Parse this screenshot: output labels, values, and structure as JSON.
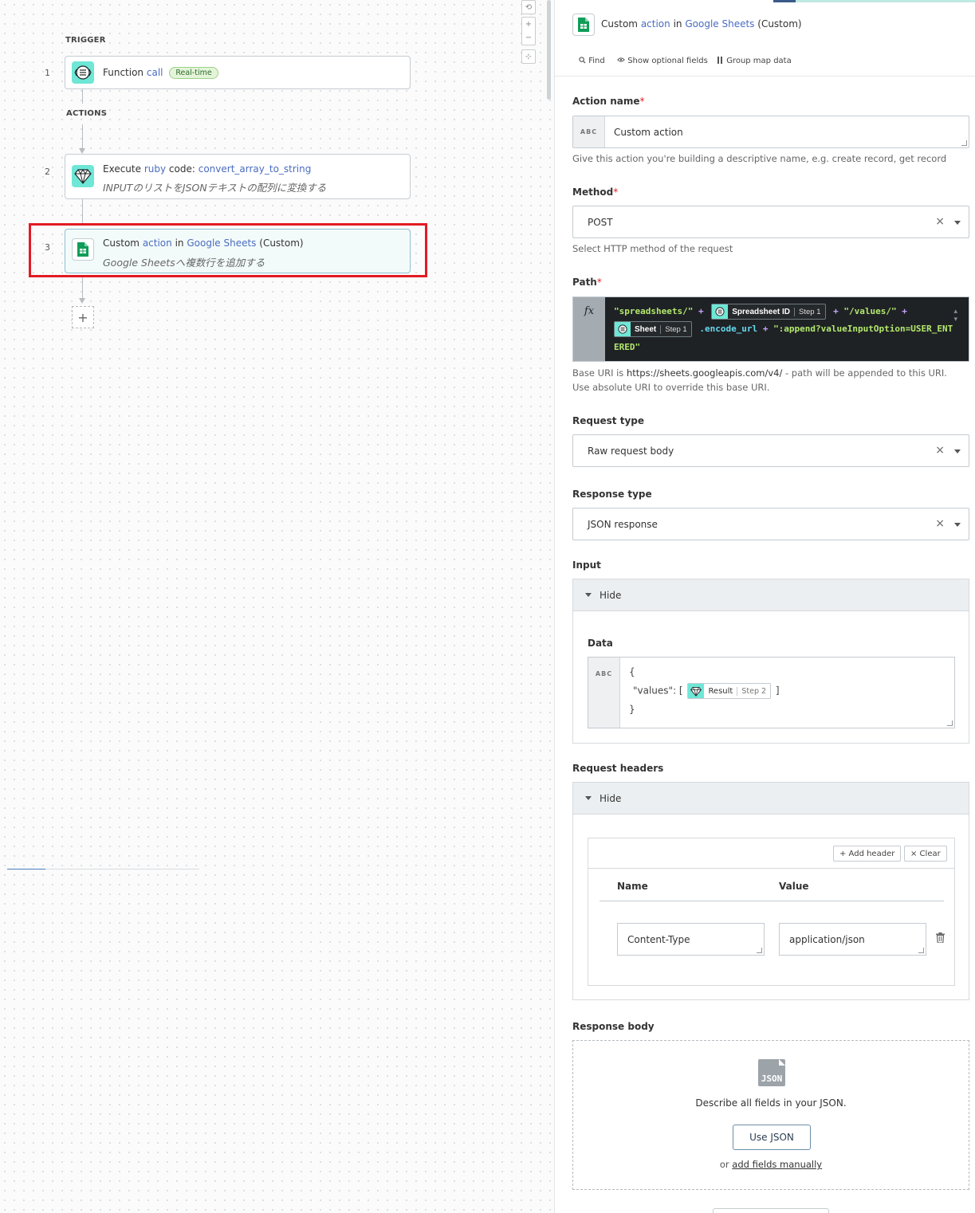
{
  "canvas": {
    "trigger_label": "TRIGGER",
    "actions_label": "ACTIONS",
    "steps": [
      {
        "num": "1",
        "prefix": "Function",
        "keyword": "call",
        "badge": "Real-time"
      },
      {
        "num": "2",
        "prefix": "Execute",
        "keyword": "ruby",
        "middle": "code:",
        "name": "convert_array_to_string",
        "description": "INPUTのリストをJSONテキストの配列に変換する"
      },
      {
        "num": "3",
        "prefix": "Custom",
        "keyword": "action",
        "middle": "in",
        "app": "Google Sheets",
        "suffix": "(Custom)",
        "description": "Google Sheetsへ複数行を追加する"
      }
    ],
    "add_step_label": "+",
    "zoom": {
      "reset": "⟲",
      "in": "+",
      "out": "−",
      "fit": "⊹"
    }
  },
  "panel": {
    "title": {
      "prefix": "Custom",
      "keyword": "action",
      "middle": "in",
      "app": "Google Sheets",
      "suffix": "(Custom)"
    },
    "toolbar": {
      "find": "Find",
      "optional": "Show optional fields",
      "group": "Group map data"
    },
    "action_name": {
      "label": "Action name",
      "value": "Custom action",
      "hint": "Give this action you're building a descriptive name, e.g. create record, get record",
      "abc": "ABC"
    },
    "method": {
      "label": "Method",
      "value": "POST",
      "hint": "Select HTTP method of the request"
    },
    "path": {
      "label": "Path",
      "fx": "fx",
      "s1": "\"spreadsheets/\"",
      "plus": "+",
      "pill1_name": "Spreadsheet ID",
      "pill1_step": "Step 1",
      "s2": "\"/values/\"",
      "pill2_name": "Sheet",
      "pill2_step": "Step 1",
      "method": ".encode_url",
      "s3": "\":append?valueInputOption=USER_ENT",
      "s4": "ERED\"",
      "hint_pre": "Base URI is",
      "hint_uri": "https://sheets.googleapis.com/v4/",
      "hint_post": "- path will be appended to this URI. Use absolute URI to override this base URI."
    },
    "request_type": {
      "label": "Request type",
      "value": "Raw request body"
    },
    "response_type": {
      "label": "Response type",
      "value": "JSON response"
    },
    "input": {
      "label": "Input",
      "toggle": "Hide",
      "data_label": "Data",
      "abc": "ABC",
      "line1": "{",
      "line2_pre": "\"values\": [",
      "pill_name": "Result",
      "pill_step": "Step 2",
      "line2_post": "]",
      "line3": "}"
    },
    "request_headers": {
      "label": "Request headers",
      "toggle": "Hide",
      "add_header": "+ Add header",
      "clear": "× Clear",
      "col_name": "Name",
      "col_value": "Value",
      "row_name": "Content-Type",
      "row_value": "application/json"
    },
    "response_body": {
      "label": "Response body",
      "icon_text": "JSON",
      "description": "Describe all fields in your JSON.",
      "use_json": "Use JSON",
      "or": "or",
      "manual": "add fields manually"
    }
  }
}
